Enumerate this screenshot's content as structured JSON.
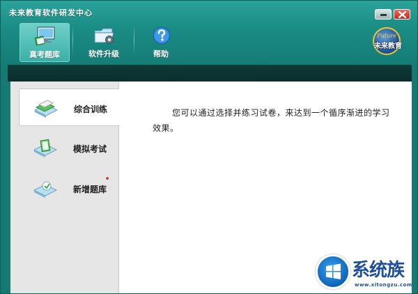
{
  "window": {
    "title": "未来教育软件研发中心"
  },
  "toolbar": {
    "items": [
      {
        "label": "真考题库",
        "icon": "monitor-books-icon",
        "active": true
      },
      {
        "label": "软件升级",
        "icon": "folder-gear-icon",
        "active": false
      },
      {
        "label": "帮助",
        "icon": "help-icon",
        "active": false
      }
    ]
  },
  "logo": {
    "en": "Future",
    "cn": "未来教育"
  },
  "sidebar": {
    "items": [
      {
        "label": "综合训练",
        "icon": "books-icon",
        "active": true
      },
      {
        "label": "模拟考试",
        "icon": "exam-icon",
        "active": false
      },
      {
        "label": "新增题库",
        "icon": "new-bank-icon",
        "active": false,
        "badge": true
      }
    ]
  },
  "content": {
    "description": "您可以通过选择并练习试卷，来达到一个循序渐进的学习效果。"
  },
  "watermark": {
    "text": "系统族",
    "url": "www.xitongzu.com"
  },
  "colors": {
    "window_teal": "#1a8c84",
    "dark_band": "#0e3b38",
    "sidebar_bg": "#e6e6e6",
    "close_red": "#c8261a"
  }
}
